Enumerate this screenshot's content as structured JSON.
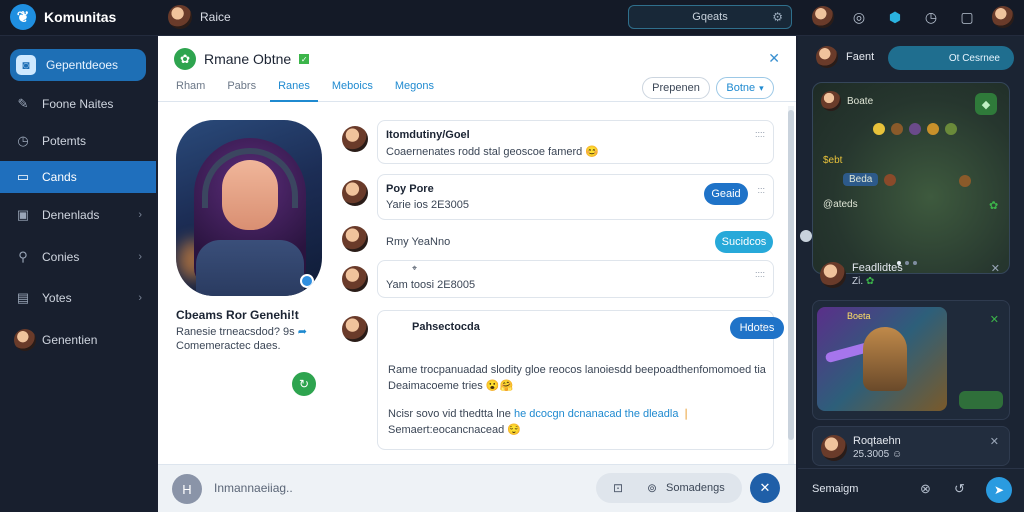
{
  "app": {
    "name": "Komunitas"
  },
  "topbar": {
    "user_name": "Raice",
    "search_text": "Gqeats"
  },
  "sidebar": {
    "items": [
      {
        "label": "Gepentdeoes",
        "icon": "community-icon"
      },
      {
        "label": "Foone Naites",
        "icon": "edit-icon"
      },
      {
        "label": "Potemts",
        "icon": "clock-icon"
      },
      {
        "label": "Cands",
        "icon": "cards-icon"
      },
      {
        "label": "Denenlads",
        "icon": "download-icon"
      },
      {
        "label": "Conies",
        "icon": "link-icon"
      },
      {
        "label": "Yotes",
        "icon": "document-icon"
      },
      {
        "label": "Genentien",
        "icon": "avatar"
      }
    ]
  },
  "modal": {
    "title": "Rmane Obtne",
    "tabs": [
      "Rham",
      "Pabrs",
      "Ranes",
      "Meboics",
      "Megons"
    ],
    "button_primary": "Prepenen",
    "button_secondary": "Botne",
    "profile": {
      "name": "Cbeams Ror Genehi!t",
      "sub1": "Ranesie trneacsdod? 9s",
      "sub2": "Comemeractec daes."
    },
    "messages": [
      {
        "title": "Itomdutiny/Goel",
        "text": "Coaernenates rodd stal geoscoe famerd",
        "meta": "::::"
      },
      {
        "title": "Poy Pore",
        "text": "Yarie ios 2E3005",
        "action": "Geaid",
        "meta": ":::"
      },
      {
        "title": "Rmy YeaNno",
        "action": "Sucidcos"
      },
      {
        "title": "",
        "text": "Yam toosi 2E8005",
        "meta": "::::"
      },
      {
        "title": "Pahsectocda",
        "action": "Hdotes",
        "meta": "::",
        "body1": "Rame trocpanuadad slodity gloe reocos  lanoiesdd beepoadthenfomomoed tia",
        "body2": "Deaimacoeme tries",
        "body3_prefix": "Ncisr sovo vid thedtta lne",
        "body3_link": "he dcocgn dcnanacad the dleadla",
        "body4": "Semaert:eocancnacead"
      }
    ],
    "composer": {
      "placeholder": "Inmannaeiiag..",
      "tool_label": "Somadengs"
    }
  },
  "right": {
    "header_name": "Faent",
    "header_button": "Ot Cesrnee",
    "board": {
      "row1": "Boate",
      "row3": "$ebt",
      "tag": "Beda",
      "row5": "@ateds"
    },
    "cards": [
      {
        "name": "Feadlidtes",
        "sub": "Zi."
      },
      {
        "name": "Roqtaehn",
        "sub": "25.3005"
      }
    ],
    "art_tag": "Boeta",
    "footer_label": "Semaigm"
  }
}
